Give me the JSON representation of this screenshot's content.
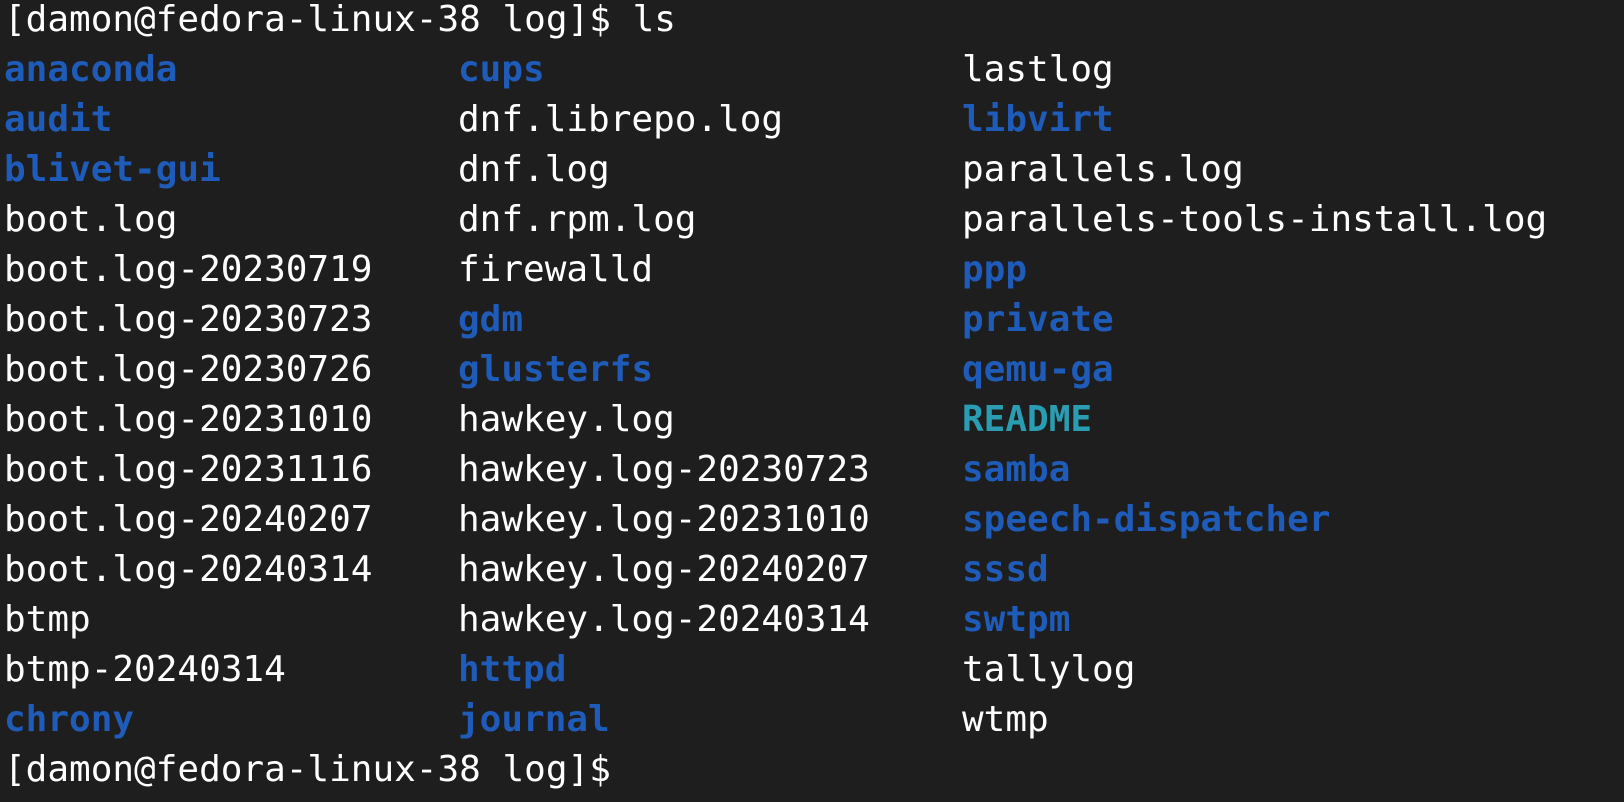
{
  "terminal": {
    "prompt": "[damon@fedora-linux-38 log]$",
    "command": "ls",
    "final_prompt": "[damon@fedora-linux-38 log]$",
    "colors": {
      "background": "#1e1e1e",
      "file": "#ffffff",
      "directory": "#1f5bb8",
      "other": "#2a9db3"
    }
  },
  "listing": {
    "columns": [
      [
        {
          "name": "anaconda",
          "type": "dir"
        },
        {
          "name": "audit",
          "type": "dir"
        },
        {
          "name": "blivet-gui",
          "type": "dir"
        },
        {
          "name": "boot.log",
          "type": "file"
        },
        {
          "name": "boot.log-20230719",
          "type": "file"
        },
        {
          "name": "boot.log-20230723",
          "type": "file"
        },
        {
          "name": "boot.log-20230726",
          "type": "file"
        },
        {
          "name": "boot.log-20231010",
          "type": "file"
        },
        {
          "name": "boot.log-20231116",
          "type": "file"
        },
        {
          "name": "boot.log-20240207",
          "type": "file"
        },
        {
          "name": "boot.log-20240314",
          "type": "file"
        },
        {
          "name": "btmp",
          "type": "file"
        },
        {
          "name": "btmp-20240314",
          "type": "file"
        },
        {
          "name": "chrony",
          "type": "dir"
        }
      ],
      [
        {
          "name": "cups",
          "type": "dir"
        },
        {
          "name": "dnf.librepo.log",
          "type": "file"
        },
        {
          "name": "dnf.log",
          "type": "file"
        },
        {
          "name": "dnf.rpm.log",
          "type": "file"
        },
        {
          "name": "firewalld",
          "type": "file"
        },
        {
          "name": "gdm",
          "type": "dir"
        },
        {
          "name": "glusterfs",
          "type": "dir"
        },
        {
          "name": "hawkey.log",
          "type": "file"
        },
        {
          "name": "hawkey.log-20230723",
          "type": "file"
        },
        {
          "name": "hawkey.log-20231010",
          "type": "file"
        },
        {
          "name": "hawkey.log-20240207",
          "type": "file"
        },
        {
          "name": "hawkey.log-20240314",
          "type": "file"
        },
        {
          "name": "httpd",
          "type": "dir"
        },
        {
          "name": "journal",
          "type": "dir"
        }
      ],
      [
        {
          "name": "lastlog",
          "type": "file"
        },
        {
          "name": "libvirt",
          "type": "dir"
        },
        {
          "name": "parallels.log",
          "type": "file"
        },
        {
          "name": "parallels-tools-install.log",
          "type": "file"
        },
        {
          "name": "ppp",
          "type": "dir"
        },
        {
          "name": "private",
          "type": "dir"
        },
        {
          "name": "qemu-ga",
          "type": "dir"
        },
        {
          "name": "README",
          "type": "other"
        },
        {
          "name": "samba",
          "type": "dir"
        },
        {
          "name": "speech-dispatcher",
          "type": "dir"
        },
        {
          "name": "sssd",
          "type": "dir"
        },
        {
          "name": "swtpm",
          "type": "dir"
        },
        {
          "name": "tallylog",
          "type": "file"
        },
        {
          "name": "wtmp",
          "type": "file"
        }
      ]
    ]
  }
}
